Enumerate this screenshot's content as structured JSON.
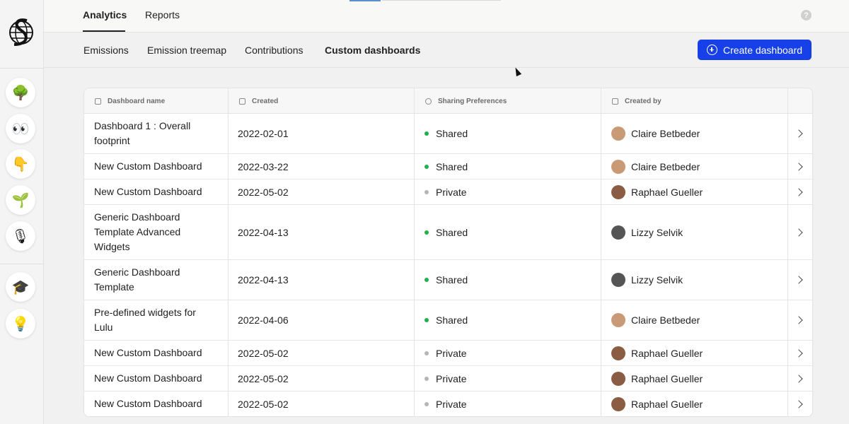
{
  "sidebar": {
    "logo_icon": "globe-s-logo",
    "items": [
      {
        "icon": "tree-emoji",
        "glyph": "🌳"
      },
      {
        "icon": "eyes-emoji",
        "glyph": "👀"
      },
      {
        "icon": "pointing-down-emoji",
        "glyph": "👇"
      },
      {
        "icon": "seedling-emoji",
        "glyph": "🌱"
      },
      {
        "icon": "microphone-emoji",
        "glyph": "🎙"
      },
      {
        "icon": "graduation-cap-emoji",
        "glyph": "🎓"
      },
      {
        "icon": "lightbulb-emoji",
        "glyph": "💡"
      }
    ]
  },
  "top_tabs": [
    {
      "label": "Analytics",
      "active": true
    },
    {
      "label": "Reports",
      "active": false
    }
  ],
  "help": {
    "label": "?"
  },
  "sub_tabs": [
    {
      "label": "Emissions",
      "active": false
    },
    {
      "label": "Emission treemap",
      "active": false
    },
    {
      "label": "Contributions",
      "active": false
    },
    {
      "label": "Custom dashboards",
      "active": true
    }
  ],
  "create_button": {
    "label": "Create dashboard",
    "icon": "plus-circle-icon"
  },
  "table": {
    "columns": [
      {
        "label": "Dashboard name",
        "icon": "grid-icon"
      },
      {
        "label": "Created",
        "icon": "calendar-icon"
      },
      {
        "label": "Sharing Preferences",
        "icon": "eye-icon"
      },
      {
        "label": "Created by",
        "icon": "user-card-icon"
      }
    ],
    "rows": [
      {
        "name": "Dashboard 1 : Overall footprint",
        "created": "2022-02-01",
        "sharing": "Shared",
        "created_by": "Claire Betbeder"
      },
      {
        "name": "New Custom Dashboard",
        "created": "2022-03-22",
        "sharing": "Shared",
        "created_by": "Claire Betbeder"
      },
      {
        "name": "New Custom Dashboard",
        "created": "2022-05-02",
        "sharing": "Private",
        "created_by": "Raphael Gueller"
      },
      {
        "name": "Generic Dashboard Template Advanced Widgets",
        "created": "2022-04-13",
        "sharing": "Shared",
        "created_by": "Lizzy Selvik"
      },
      {
        "name": "Generic Dashboard Template",
        "created": "2022-04-13",
        "sharing": "Shared",
        "created_by": "Lizzy Selvik"
      },
      {
        "name": "Pre-defined widgets for Lulu",
        "created": "2022-04-06",
        "sharing": "Shared",
        "created_by": "Claire Betbeder"
      },
      {
        "name": "New Custom Dashboard",
        "created": "2022-05-02",
        "sharing": "Private",
        "created_by": "Raphael Gueller"
      },
      {
        "name": "New Custom Dashboard",
        "created": "2022-05-02",
        "sharing": "Private",
        "created_by": "Raphael Gueller"
      },
      {
        "name": "New Custom Dashboard",
        "created": "2022-05-02",
        "sharing": "Private",
        "created_by": "Raphael Gueller"
      }
    ]
  },
  "colors": {
    "accent": "#1740e8",
    "shared_dot": "#22b04a",
    "private_dot": "#b5b5b5",
    "avatar_claire": "#c99a76",
    "avatar_raphael": "#8a5c44",
    "avatar_lizzy": "#555555"
  }
}
